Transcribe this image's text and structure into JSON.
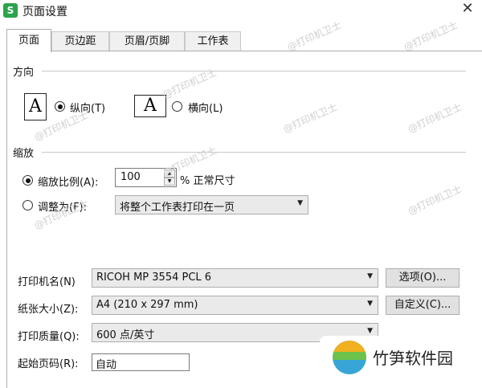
{
  "window": {
    "title": "页面设置",
    "app_icon_letter": "S",
    "close_glyph": "✕"
  },
  "tabs": [
    {
      "label": "页面",
      "active": true
    },
    {
      "label": "页边距",
      "active": false
    },
    {
      "label": "页眉/页脚",
      "active": false
    },
    {
      "label": "工作表",
      "active": false
    }
  ],
  "orientation": {
    "group_label": "方向",
    "icon_letter": "A",
    "portrait_label": "纵向(T)",
    "landscape_label": "横向(L)",
    "selected": "portrait"
  },
  "scaling": {
    "group_label": "缩放",
    "scale_label": "缩放比例(A):",
    "scale_value": "100",
    "scale_suffix": "% 正常尺寸",
    "fit_label": "调整为(F):",
    "fit_option": "将整个工作表打印在一页",
    "selected": "scale"
  },
  "printer": {
    "label": "打印机名(N)",
    "value": "RICOH MP 3554 PCL 6",
    "options_button": "选项(O)..."
  },
  "paper": {
    "label": "纸张大小(Z):",
    "value": "A4 (210 x 297 mm)",
    "custom_button": "自定义(C)..."
  },
  "quality": {
    "label": "打印质量(Q):",
    "value": "600 点/英寸"
  },
  "first_page": {
    "label": "起始页码(R):",
    "value": "自动"
  },
  "watermark": {
    "text": "@打印机卫士"
  },
  "brand": {
    "name": "竹笋软件园"
  }
}
